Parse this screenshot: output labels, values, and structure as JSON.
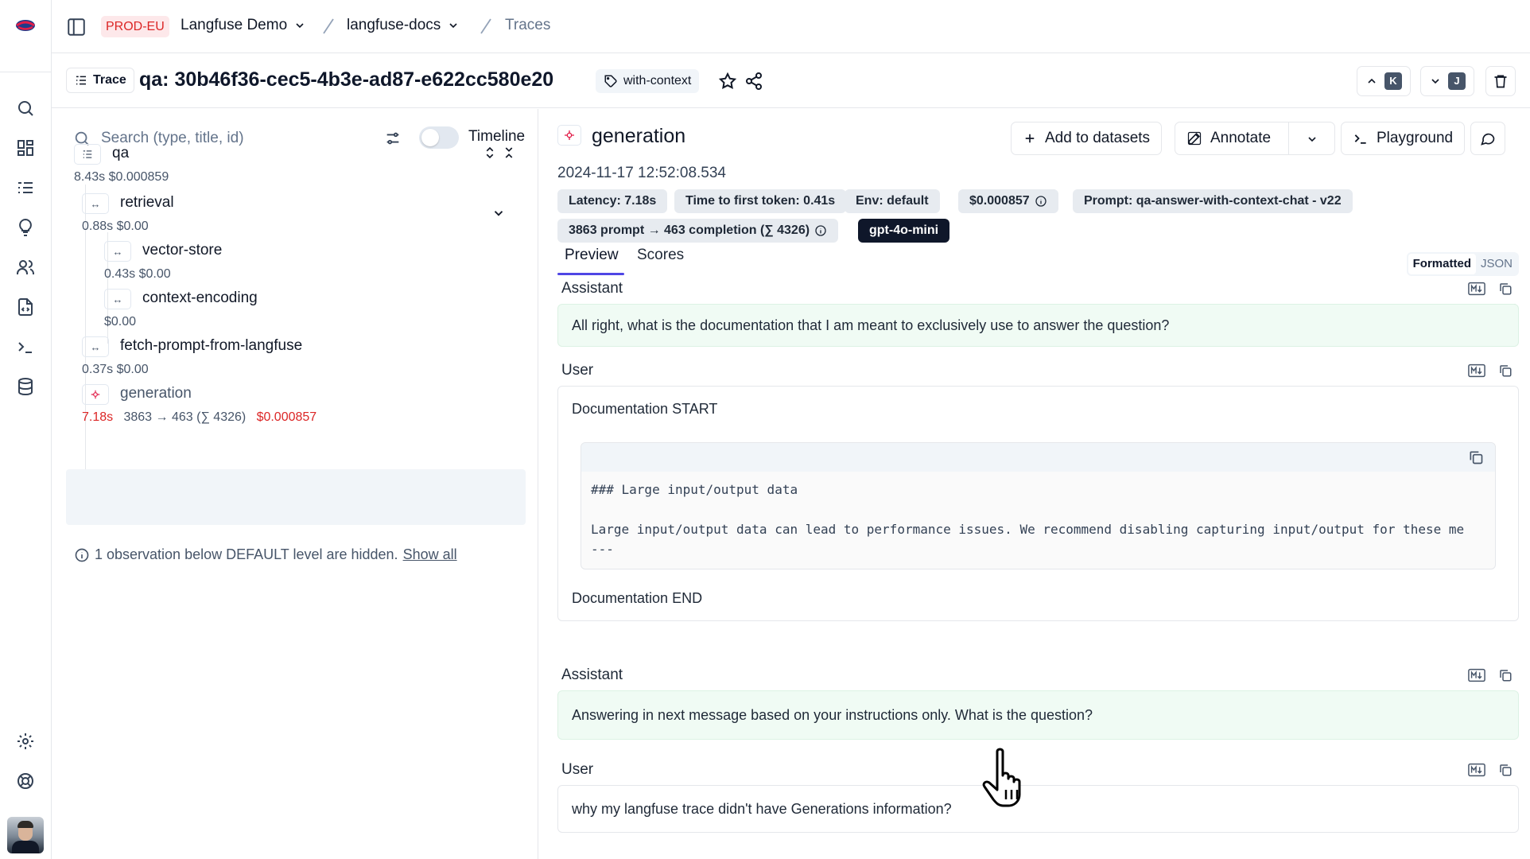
{
  "topbar": {
    "env_badge": "PROD-EU",
    "org": "Langfuse Demo",
    "project": "langfuse-docs",
    "page": "Traces"
  },
  "trace": {
    "pill_label": "Trace",
    "title": "qa: 30b46f36-cec5-4b3e-ad87-e622cc580e20",
    "tag": "with-context",
    "prev_key": "K",
    "next_key": "J"
  },
  "tree": {
    "search_placeholder": "Search (type, title, id)",
    "timeline_label": "Timeline",
    "nodes": [
      {
        "name": "qa",
        "meta": "8.43s  $0.000859"
      },
      {
        "name": "retrieval",
        "meta": "0.88s  $0.00"
      },
      {
        "name": "vector-store",
        "meta": "0.43s  $0.00"
      },
      {
        "name": "context-encoding",
        "meta": "$0.00"
      },
      {
        "name": "fetch-prompt-from-langfuse",
        "meta": "0.37s  $0.00"
      },
      {
        "name": "generation",
        "latency": "7.18s",
        "tokens": "3863 → 463 (∑ 4326)",
        "cost": "$0.000857"
      }
    ],
    "hidden_note": "1 observation below DEFAULT level are hidden.",
    "show_all": "Show all"
  },
  "detail": {
    "title": "generation",
    "timestamp": "2024-11-17 12:52:08.534",
    "buttons": {
      "add_to_datasets": "Add to datasets",
      "annotate": "Annotate",
      "playground": "Playground"
    },
    "chips": {
      "latency": "Latency: 7.18s",
      "ttft": "Time to first token: 0.41s",
      "env": "Env: default",
      "cost": "$0.000857",
      "prompt": "Prompt: qa-answer-with-context-chat - v22",
      "usage": "3863 prompt → 463 completion (∑ 4326)",
      "model": "gpt-4o-mini"
    },
    "tabs": [
      "Preview",
      "Scores"
    ],
    "format_toggle": {
      "formatted": "Formatted",
      "json": "JSON"
    },
    "messages": [
      {
        "role": "Assistant",
        "text": "All right, what is the documentation that I am meant to exclusively use to answer the question?"
      },
      {
        "role": "User",
        "doc_start": "Documentation START",
        "code_line1": "### Large input/output data",
        "code_line2": "Large input/output data can lead to performance issues. We recommend disabling capturing input/output for these me",
        "code_line3": "---",
        "doc_end": "Documentation END"
      },
      {
        "role": "Assistant",
        "text": "Answering in next message based on your instructions only. What is the question?"
      },
      {
        "role": "User",
        "text": "why my langfuse trace didn't have Generations information?"
      }
    ]
  },
  "colors": {
    "accent": "#4f46e5",
    "env_badge_bg": "#fde8ea",
    "env_badge_text": "#dc2626",
    "assistant_bg": "#f0fbf4",
    "model_chip": "#0f172a",
    "cost_red": "#dc2626"
  }
}
